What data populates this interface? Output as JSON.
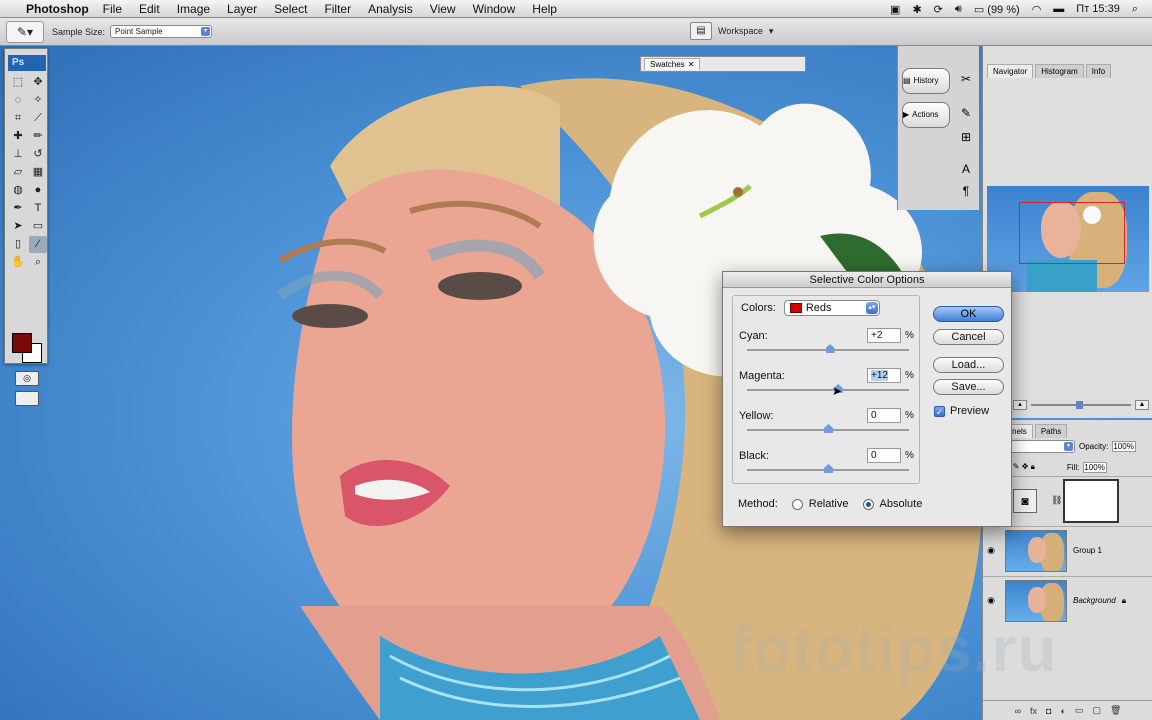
{
  "menubar": {
    "app_name": "Photoshop",
    "items": [
      "File",
      "Edit",
      "Image",
      "Layer",
      "Select",
      "Filter",
      "Analysis",
      "View",
      "Window",
      "Help"
    ],
    "battery": "(99 %)",
    "clock": "Пт 15:39"
  },
  "options_bar": {
    "sample_size_label": "Sample Size:",
    "sample_size_value": "Point Sample",
    "workspace_label": "Workspace"
  },
  "toolbox": {
    "logo": "Ps",
    "foreground_color": "#7a0a0a",
    "background_color": "#ffffff"
  },
  "swatches_panel": {
    "tab": "Swatches"
  },
  "dock": {
    "history_label": "History",
    "actions_label": "Actions"
  },
  "navigator_panel": {
    "tabs": [
      "Navigator",
      "Histogram",
      "Info"
    ]
  },
  "layers_panel": {
    "tabs": [
      "Channels",
      "Paths"
    ],
    "opacity_label": "Opacity:",
    "opacity_value": "100%",
    "fill_label": "Fill:",
    "fill_value": "100%",
    "layers": [
      {
        "name": "Group 1"
      },
      {
        "name": "Background"
      }
    ]
  },
  "dialog": {
    "title": "Selective Color Options",
    "colors_label": "Colors:",
    "colors_value": "Reds",
    "colors_swatch": "#d40000",
    "sliders": [
      {
        "label": "Cyan:",
        "value": "+2",
        "num": 2
      },
      {
        "label": "Magenta:",
        "value": "+12",
        "num": 12
      },
      {
        "label": "Yellow:",
        "value": "0",
        "num": 0
      },
      {
        "label": "Black:",
        "value": "0",
        "num": 0
      }
    ],
    "percent": "%",
    "method_label": "Method:",
    "method_relative": "Relative",
    "method_absolute": "Absolute",
    "method_selected": "Absolute",
    "buttons": {
      "ok": "OK",
      "cancel": "Cancel",
      "load": "Load...",
      "save": "Save..."
    },
    "preview_label": "Preview",
    "preview_checked": true
  },
  "watermark": "fototips.ru"
}
